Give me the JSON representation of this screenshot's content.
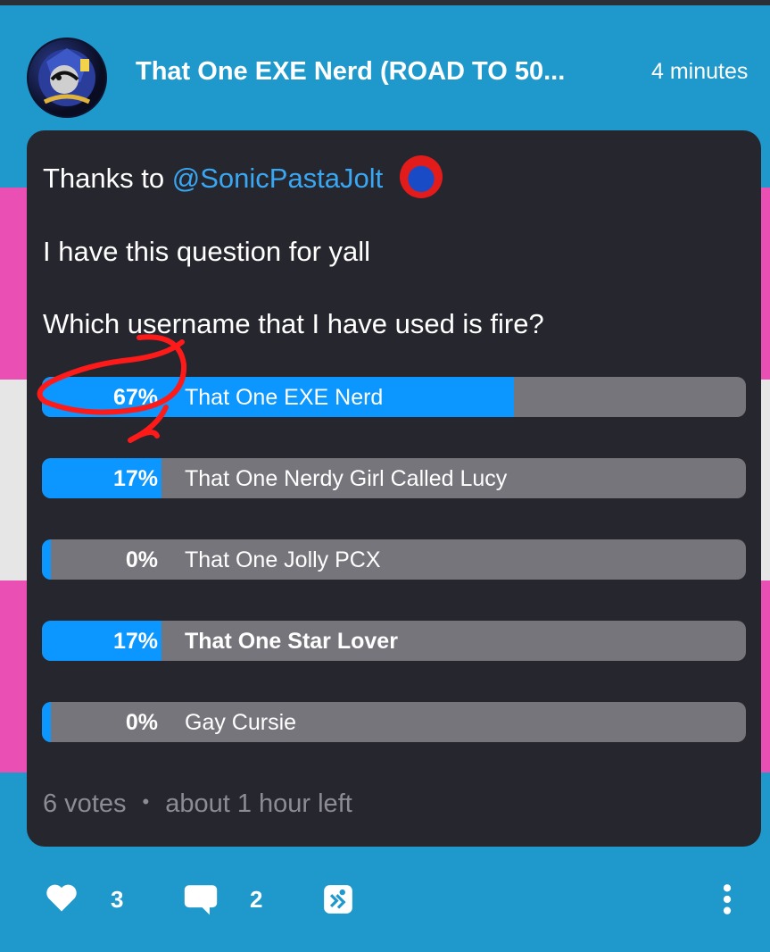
{
  "post": {
    "author": "That One EXE Nerd (ROAD TO 50...",
    "time": "4 minutes",
    "mention_prefix": "Thanks to",
    "mention": "@SonicPastaJolt",
    "line2": "I have this question for yall",
    "question": "Which username that I have used is fire?"
  },
  "poll": {
    "options": [
      {
        "percent": "67%",
        "label": "That One EXE Nerd",
        "fill": 0.67
      },
      {
        "percent": "17%",
        "label": "That One Nerdy Girl Called Lucy",
        "fill": 0.17
      },
      {
        "percent": "0%",
        "label": "That One Jolly PCX",
        "fill": 0.0
      },
      {
        "percent": "17%",
        "label": "That One Star Lover",
        "fill": 0.17,
        "selected": true
      },
      {
        "percent": "0%",
        "label": "Gay Cursie",
        "fill": 0.0
      }
    ],
    "votes": "6 votes",
    "separator": "•",
    "time_left": "about 1 hour left"
  },
  "actions": {
    "like_count": "3",
    "comment_count": "2"
  },
  "colors": {
    "accent": "#0b97ff",
    "mention": "#3aa7f3",
    "card": "#26262e",
    "track": "#76757b",
    "annotation": "#ff1a1a"
  },
  "icons": [
    "heart-icon",
    "comment-icon",
    "share-icon",
    "more-icon"
  ]
}
